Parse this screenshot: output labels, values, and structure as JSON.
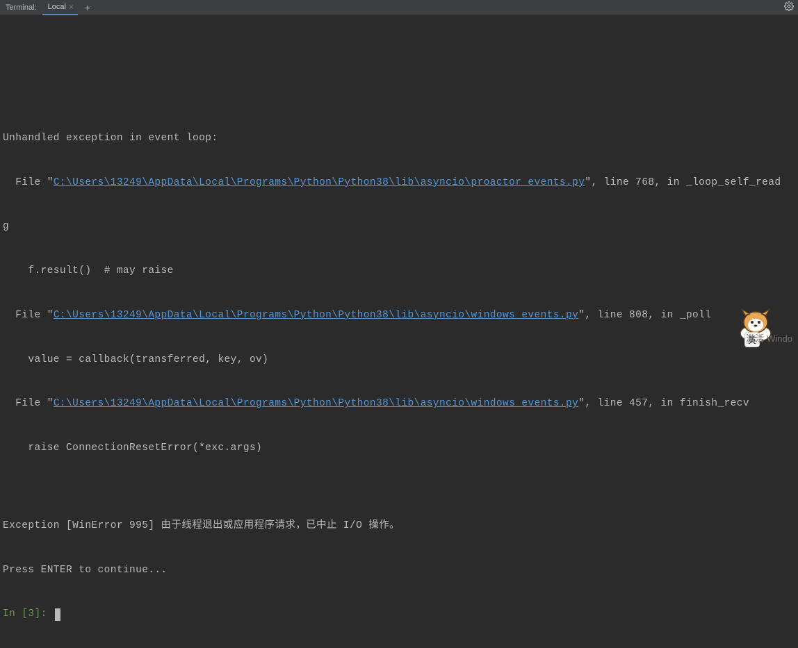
{
  "tabbar": {
    "panel_label": "Terminal:",
    "active_tab": "Local",
    "close_glyph": "×",
    "add_glyph": "+"
  },
  "terminal": {
    "line_header": "Unhandled exception in event loop:",
    "frame1_pre": "  File \"",
    "frame1_path": "C:\\Users\\13249\\AppData\\Local\\Programs\\Python\\Python38\\lib\\asyncio\\proactor_events.py",
    "frame1_post": "\", line 768, in _loop_self_read",
    "frame1_wrap": "g",
    "frame1_code": "    f.result()  # may raise",
    "frame2_pre": "  File \"",
    "frame2_path": "C:\\Users\\13249\\AppData\\Local\\Programs\\Python\\Python38\\lib\\asyncio\\windows_events.py",
    "frame2_post": "\", line 808, in _poll",
    "frame2_code": "    value = callback(transferred, key, ov)",
    "frame3_pre": "  File \"",
    "frame3_path": "C:\\Users\\13249\\AppData\\Local\\Programs\\Python\\Python38\\lib\\asyncio\\windows_events.py",
    "frame3_post": "\", line 457, in finish_recv",
    "frame3_code": "    raise ConnectionResetError(*exc.args)",
    "exception_line": "Exception [WinError 995] 由于线程退出或应用程序请求，已中止 I/O 操作。",
    "press_enter": "Press ENTER to continue...",
    "prompt_in": "In [",
    "prompt_num": "3",
    "prompt_tail": "]: "
  },
  "overlay": {
    "watermark": "激活 Windo",
    "ime": "英"
  }
}
